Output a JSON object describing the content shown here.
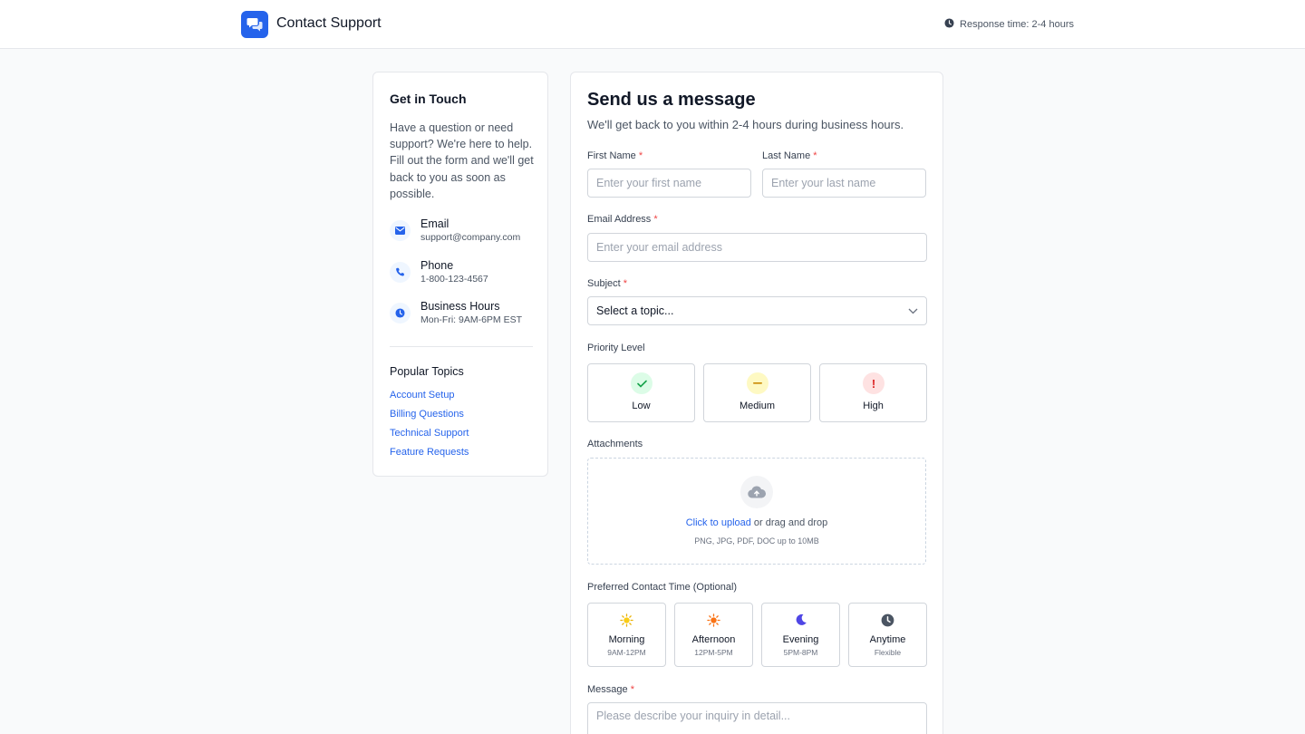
{
  "header": {
    "title": "Contact Support",
    "logo_icon": "chat-bubbles-icon",
    "response_time": "Response time: 2-4 hours",
    "accent": "#2563eb"
  },
  "sidebar": {
    "title": "Get in Touch",
    "intro": "Have a question or need support? We're here to help. Fill out the form and we'll get back to you as soon as possible.",
    "contacts": [
      {
        "icon": "envelope-icon",
        "label": "Email",
        "value": "support@company.com"
      },
      {
        "icon": "phone-icon",
        "label": "Phone",
        "value": "1-800-123-4567"
      },
      {
        "icon": "clock-icon",
        "label": "Business Hours",
        "value": "Mon-Fri: 9AM-6PM EST"
      }
    ],
    "topics_title": "Popular Topics",
    "topics": [
      "Account Setup",
      "Billing Questions",
      "Technical Support",
      "Feature Requests"
    ]
  },
  "form": {
    "title": "Send us a message",
    "subtitle": "We'll get back to you within 2-4 hours during business hours.",
    "first_name": {
      "label": "First Name",
      "placeholder": "Enter your first name",
      "required": "*"
    },
    "last_name": {
      "label": "Last Name",
      "placeholder": "Enter your last name",
      "required": "*"
    },
    "email": {
      "label": "Email Address",
      "placeholder": "Enter your email address",
      "required": "*"
    },
    "subject": {
      "label": "Subject",
      "selected": "Select a topic...",
      "required": "*"
    },
    "priority": {
      "label": "Priority Level",
      "options": [
        {
          "label": "Low",
          "icon": "check-icon",
          "color": "#16a34a",
          "bg": "#dcfce7"
        },
        {
          "label": "Medium",
          "icon": "minus-icon",
          "color": "#ca8a04",
          "bg": "#fef9c3"
        },
        {
          "label": "High",
          "icon": "exclamation-icon",
          "color": "#dc2626",
          "bg": "#fee2e2"
        }
      ]
    },
    "attachments": {
      "label": "Attachments",
      "link": "Click to upload",
      "text": " or drag and drop",
      "hint": "PNG, JPG, PDF, DOC up to 10MB"
    },
    "contact_time": {
      "label": "Preferred Contact Time (Optional)",
      "options": [
        {
          "label": "Morning",
          "sub": "9AM-12PM",
          "icon": "sun-icon"
        },
        {
          "label": "Afternoon",
          "sub": "12PM-5PM",
          "icon": "sun-bright-icon"
        },
        {
          "label": "Evening",
          "sub": "5PM-8PM",
          "icon": "moon-icon"
        },
        {
          "label": "Anytime",
          "sub": "Flexible",
          "icon": "clock-icon"
        }
      ]
    },
    "message": {
      "label": "Message",
      "placeholder": "Please describe your inquiry in detail...",
      "required": "*"
    }
  }
}
